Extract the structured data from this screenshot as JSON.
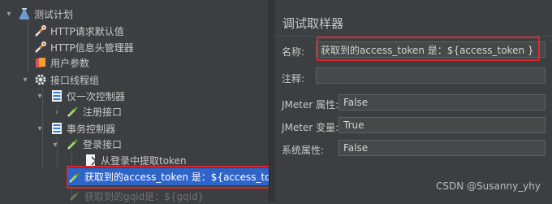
{
  "tree": {
    "test_plan": "测试计划",
    "http_defaults": "HTTP请求默认值",
    "http_headers": "HTTP信息头管理器",
    "user_params": "用户参数",
    "thread_group": "接口线程组",
    "once_controller": "仅一次控制器",
    "register_api": "注册接口",
    "transaction_controller": "事务控制器",
    "login_api": "登录接口",
    "extract_token": "从登录中提取token",
    "debug_sampler": "获取到的access_token 是：${access_toke",
    "gqid_sampler": "获取到的gqid是：${gqid}"
  },
  "panel": {
    "title": "调试取样器",
    "name_label": "名称:",
    "name_value": "获取到的access_token 是：${access_token }",
    "comment_label": "注释:",
    "comment_value": "",
    "jmeter_props_label": "JMeter 属性:",
    "jmeter_props_value": "False",
    "jmeter_vars_label": "JMeter 变量:",
    "jmeter_vars_value": "True",
    "sys_props_label": "系统属性:",
    "sys_props_value": "False"
  },
  "watermark": "CSDN @Susanny_yhy",
  "colors": {
    "background": "#3c3f41",
    "selection": "#2f65ca",
    "highlight_box": "#e0242c"
  }
}
